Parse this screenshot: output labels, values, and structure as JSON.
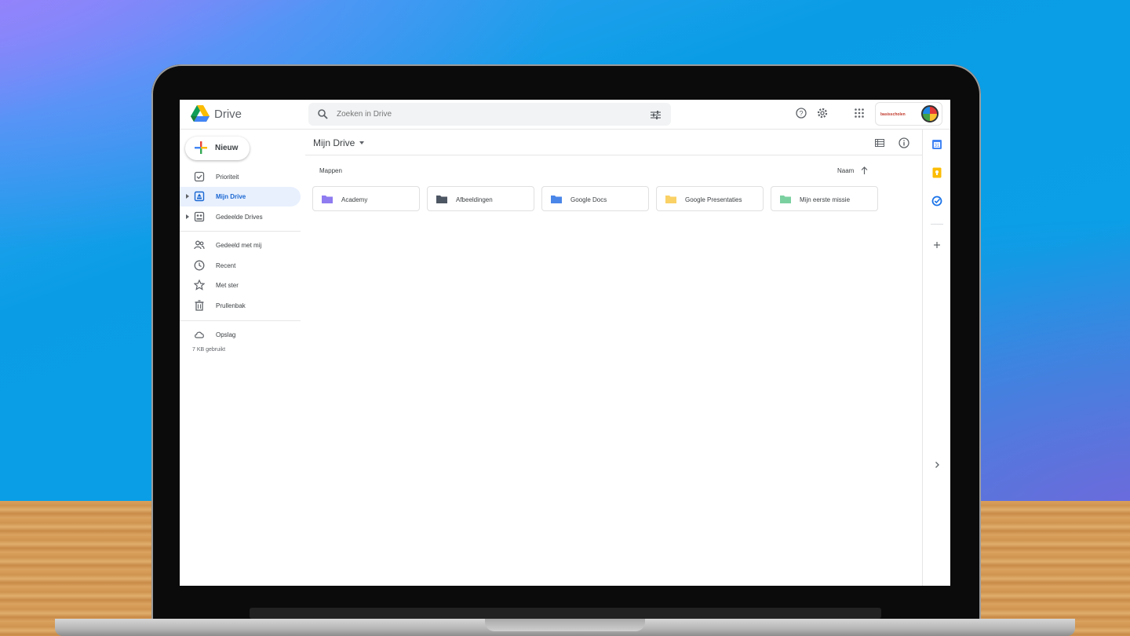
{
  "app": {
    "brand": "Drive"
  },
  "search": {
    "placeholder": "Zoeken in Drive"
  },
  "header": {
    "icons": [
      "help-icon",
      "settings-icon",
      "apps-grid-icon"
    ],
    "org_logo_text": "basisscholen"
  },
  "sidebar": {
    "new_label": "Nieuw",
    "items": [
      {
        "label": "Prioriteit",
        "icon": "priority-check-icon"
      },
      {
        "label": "Mijn Drive",
        "icon": "my-drive-icon",
        "active": true
      },
      {
        "label": "Gedeelde Drives",
        "icon": "shared-drives-icon"
      },
      {
        "label": "Gedeeld met mij",
        "icon": "shared-with-me-icon"
      },
      {
        "label": "Recent",
        "icon": "clock-icon"
      },
      {
        "label": "Met ster",
        "icon": "star-icon"
      },
      {
        "label": "Prullenbak",
        "icon": "trash-icon"
      },
      {
        "label": "Opslag",
        "icon": "cloud-icon"
      }
    ],
    "storage_text": "7 KB gebruikt"
  },
  "main": {
    "breadcrumb": "Mijn Drive",
    "section_label": "Mappen",
    "sort_label": "Naam",
    "folders": [
      {
        "label": "Academy",
        "color": "#8e7cf0"
      },
      {
        "label": "Afbeeldingen",
        "color": "#4d5663"
      },
      {
        "label": "Google Docs",
        "color": "#4a86e8"
      },
      {
        "label": "Google Presentaties",
        "color": "#fad165"
      },
      {
        "label": "Mijn eerste missie",
        "color": "#7bd0a0"
      }
    ]
  },
  "rail": {
    "icons": [
      "calendar-icon",
      "keep-icon",
      "tasks-icon",
      "add-addon-icon",
      "expand-panel-icon"
    ]
  }
}
